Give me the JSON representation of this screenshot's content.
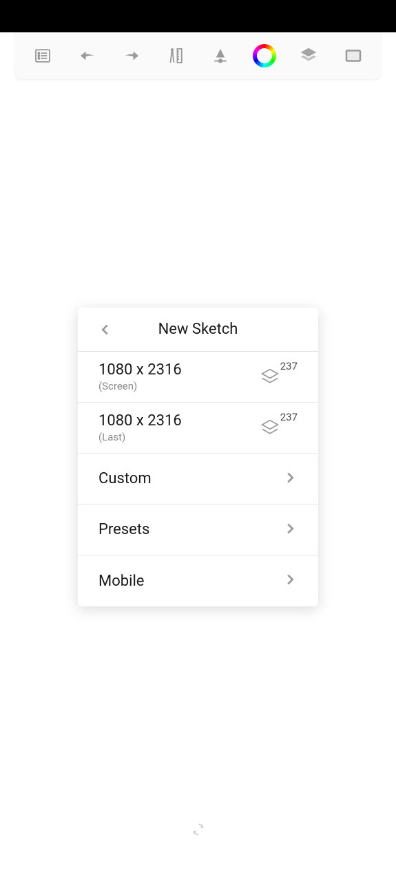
{
  "dialog": {
    "title": "New Sketch",
    "items": [
      {
        "primary": "1080 x 2316",
        "secondary": "(Screen)",
        "badge": "237",
        "type": "size"
      },
      {
        "primary": "1080 x 2316",
        "secondary": "(Last)",
        "badge": "237",
        "type": "size"
      },
      {
        "primary": "Custom",
        "type": "nav"
      },
      {
        "primary": "Presets",
        "type": "nav"
      },
      {
        "primary": "Mobile",
        "type": "nav"
      }
    ]
  }
}
